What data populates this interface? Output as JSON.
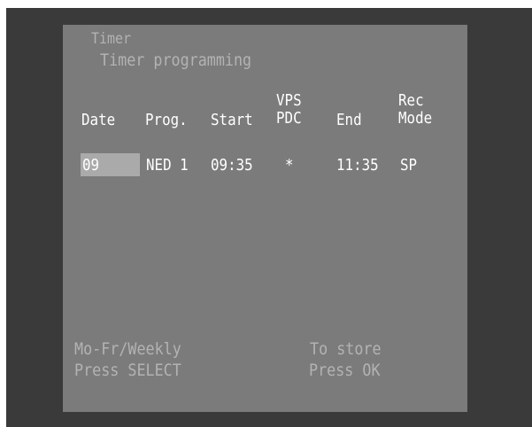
{
  "header": {
    "menu_title": "Timer",
    "screen_title": "Timer programming"
  },
  "columns": {
    "date": "Date",
    "prog": "Prog.",
    "start": "Start",
    "vps_line1": "VPS",
    "vps_line2": "PDC",
    "end": "End",
    "rec_line1": "Rec",
    "rec_line2": "Mode"
  },
  "entry": {
    "date": "09",
    "prog": "NED 1",
    "start": "09:35",
    "vps": "*",
    "end": "11:35",
    "mode": "SP"
  },
  "footer": {
    "left_line1": "Mo-Fr/Weekly",
    "left_line2": "Press SELECT",
    "right_line1": "To store",
    "right_line2": "Press OK"
  },
  "colors": {
    "frame": "#3a3a3a",
    "panel": "#7b7b7b",
    "selection": "#aaaaaa",
    "text_bright": "#ffffff",
    "text_dim": "#b3b3b3"
  }
}
